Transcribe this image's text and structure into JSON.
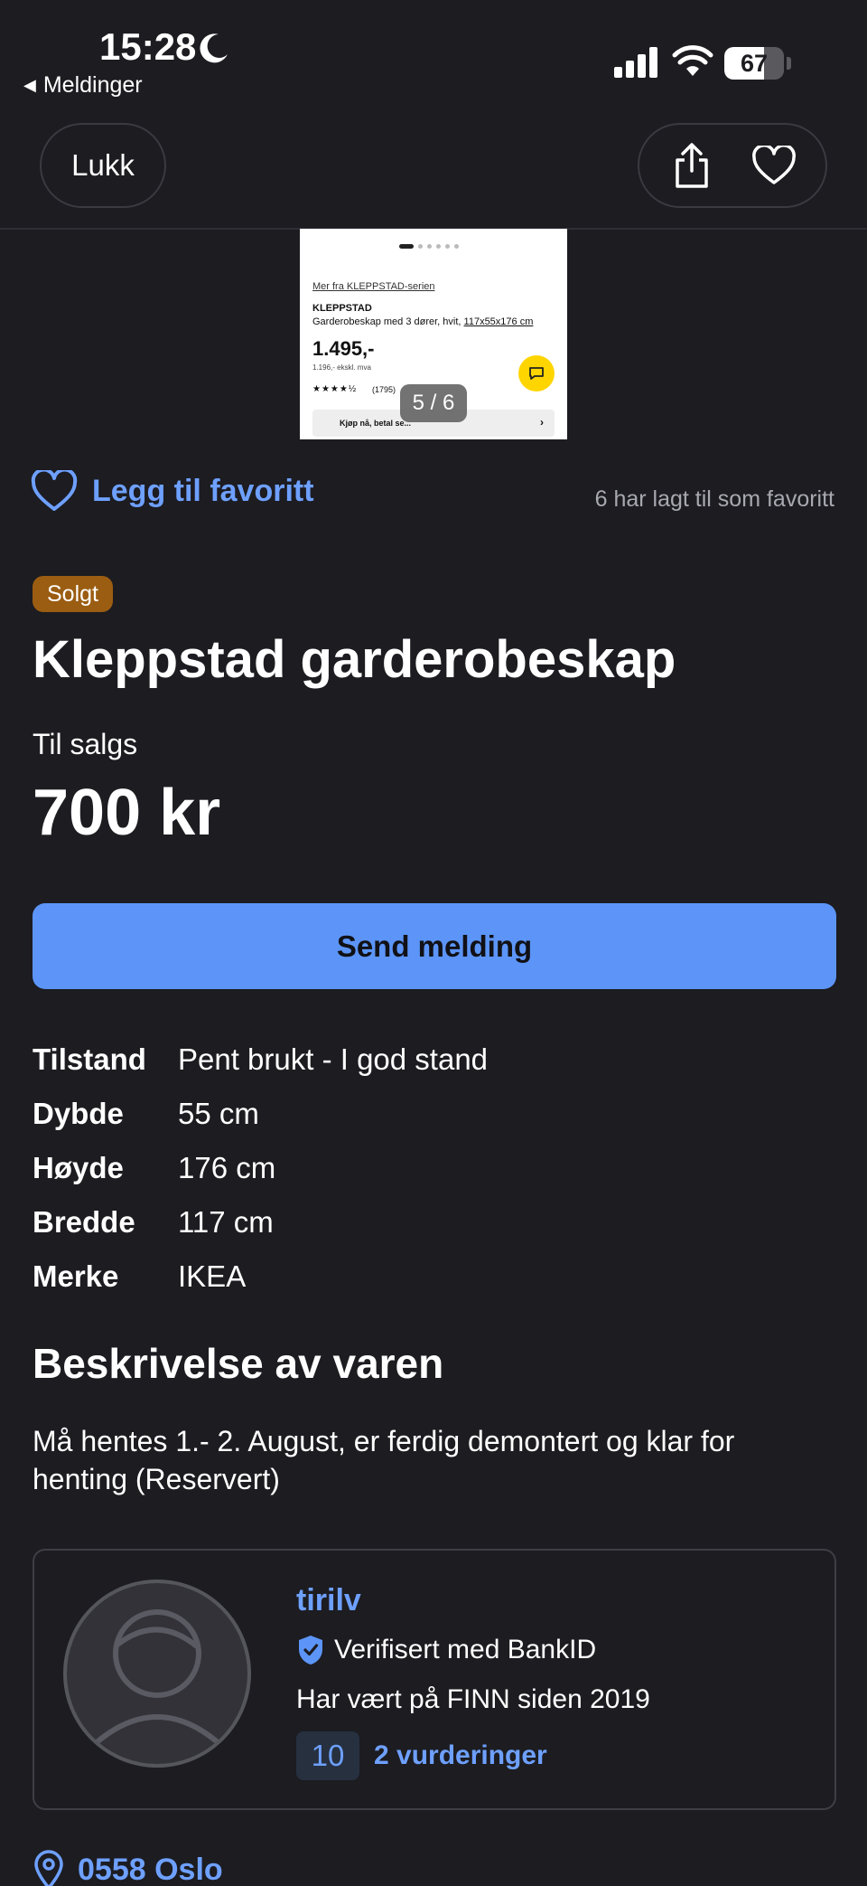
{
  "status_bar": {
    "time": "15:28",
    "back_label": "Meldinger",
    "battery_level": "67",
    "battery_fraction": 0.67
  },
  "nav": {
    "close_label": "Lukk",
    "share_icon": "share-icon",
    "favorite_icon": "heart-icon"
  },
  "gallery": {
    "counter": "5 / 6",
    "image_text": {
      "link": "Mer fra KLEPPSTAD-serien",
      "brand": "KLEPPSTAD",
      "desc_prefix": "Garderobeskap med 3 dører, hvit, ",
      "desc_dims": "117x55x176 cm",
      "price": "1.495,-",
      "vat": "1.196,- ekskl. mva",
      "stars": "★★★★½",
      "count": "(1795)",
      "bar": "Kjøp nå, betal se..."
    }
  },
  "favorite": {
    "label": "Legg til favoritt",
    "count_text": "6 har lagt til som favoritt"
  },
  "listing": {
    "badge": "Solgt",
    "title": "Kleppstad garderobeskap",
    "sale_type": "Til salgs",
    "price": "700 kr",
    "send_button": "Send melding"
  },
  "specs": [
    {
      "key": "Tilstand",
      "value": "Pent brukt - I god stand"
    },
    {
      "key": "Dybde",
      "value": "55 cm"
    },
    {
      "key": "Høyde",
      "value": "176 cm"
    },
    {
      "key": "Bredde",
      "value": "117 cm"
    },
    {
      "key": "Merke",
      "value": "IKEA"
    }
  ],
  "description": {
    "heading": "Beskrivelse av varen",
    "text": "Må hentes 1.- 2. August, er ferdig demontert og klar for henting (Reservert)"
  },
  "seller": {
    "name": "tirilv",
    "verified": "Verifisert med BankID",
    "member_since": "Har vært på FINN siden 2019",
    "rating": "10",
    "reviews": "2 vurderinger"
  },
  "location": {
    "text": "0558 Oslo"
  },
  "colors": {
    "background": "#1c1c21",
    "accent": "#6ea0ff",
    "button": "#5c95f7",
    "sold_badge": "#9b5d12"
  }
}
